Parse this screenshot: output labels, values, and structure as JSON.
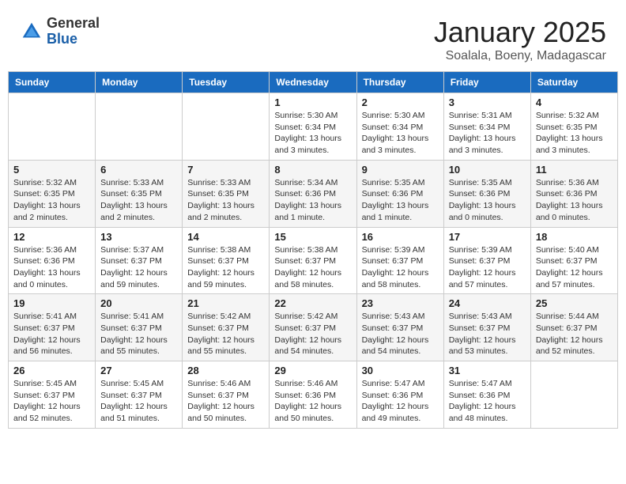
{
  "logo": {
    "general": "General",
    "blue": "Blue"
  },
  "header": {
    "month": "January 2025",
    "location": "Soalala, Boeny, Madagascar"
  },
  "weekdays": [
    "Sunday",
    "Monday",
    "Tuesday",
    "Wednesday",
    "Thursday",
    "Friday",
    "Saturday"
  ],
  "weeks": [
    [
      {
        "day": "",
        "info": ""
      },
      {
        "day": "",
        "info": ""
      },
      {
        "day": "",
        "info": ""
      },
      {
        "day": "1",
        "info": "Sunrise: 5:30 AM\nSunset: 6:34 PM\nDaylight: 13 hours\nand 3 minutes."
      },
      {
        "day": "2",
        "info": "Sunrise: 5:30 AM\nSunset: 6:34 PM\nDaylight: 13 hours\nand 3 minutes."
      },
      {
        "day": "3",
        "info": "Sunrise: 5:31 AM\nSunset: 6:34 PM\nDaylight: 13 hours\nand 3 minutes."
      },
      {
        "day": "4",
        "info": "Sunrise: 5:32 AM\nSunset: 6:35 PM\nDaylight: 13 hours\nand 3 minutes."
      }
    ],
    [
      {
        "day": "5",
        "info": "Sunrise: 5:32 AM\nSunset: 6:35 PM\nDaylight: 13 hours\nand 2 minutes."
      },
      {
        "day": "6",
        "info": "Sunrise: 5:33 AM\nSunset: 6:35 PM\nDaylight: 13 hours\nand 2 minutes."
      },
      {
        "day": "7",
        "info": "Sunrise: 5:33 AM\nSunset: 6:35 PM\nDaylight: 13 hours\nand 2 minutes."
      },
      {
        "day": "8",
        "info": "Sunrise: 5:34 AM\nSunset: 6:36 PM\nDaylight: 13 hours\nand 1 minute."
      },
      {
        "day": "9",
        "info": "Sunrise: 5:35 AM\nSunset: 6:36 PM\nDaylight: 13 hours\nand 1 minute."
      },
      {
        "day": "10",
        "info": "Sunrise: 5:35 AM\nSunset: 6:36 PM\nDaylight: 13 hours\nand 0 minutes."
      },
      {
        "day": "11",
        "info": "Sunrise: 5:36 AM\nSunset: 6:36 PM\nDaylight: 13 hours\nand 0 minutes."
      }
    ],
    [
      {
        "day": "12",
        "info": "Sunrise: 5:36 AM\nSunset: 6:36 PM\nDaylight: 13 hours\nand 0 minutes."
      },
      {
        "day": "13",
        "info": "Sunrise: 5:37 AM\nSunset: 6:37 PM\nDaylight: 12 hours\nand 59 minutes."
      },
      {
        "day": "14",
        "info": "Sunrise: 5:38 AM\nSunset: 6:37 PM\nDaylight: 12 hours\nand 59 minutes."
      },
      {
        "day": "15",
        "info": "Sunrise: 5:38 AM\nSunset: 6:37 PM\nDaylight: 12 hours\nand 58 minutes."
      },
      {
        "day": "16",
        "info": "Sunrise: 5:39 AM\nSunset: 6:37 PM\nDaylight: 12 hours\nand 58 minutes."
      },
      {
        "day": "17",
        "info": "Sunrise: 5:39 AM\nSunset: 6:37 PM\nDaylight: 12 hours\nand 57 minutes."
      },
      {
        "day": "18",
        "info": "Sunrise: 5:40 AM\nSunset: 6:37 PM\nDaylight: 12 hours\nand 57 minutes."
      }
    ],
    [
      {
        "day": "19",
        "info": "Sunrise: 5:41 AM\nSunset: 6:37 PM\nDaylight: 12 hours\nand 56 minutes."
      },
      {
        "day": "20",
        "info": "Sunrise: 5:41 AM\nSunset: 6:37 PM\nDaylight: 12 hours\nand 55 minutes."
      },
      {
        "day": "21",
        "info": "Sunrise: 5:42 AM\nSunset: 6:37 PM\nDaylight: 12 hours\nand 55 minutes."
      },
      {
        "day": "22",
        "info": "Sunrise: 5:42 AM\nSunset: 6:37 PM\nDaylight: 12 hours\nand 54 minutes."
      },
      {
        "day": "23",
        "info": "Sunrise: 5:43 AM\nSunset: 6:37 PM\nDaylight: 12 hours\nand 54 minutes."
      },
      {
        "day": "24",
        "info": "Sunrise: 5:43 AM\nSunset: 6:37 PM\nDaylight: 12 hours\nand 53 minutes."
      },
      {
        "day": "25",
        "info": "Sunrise: 5:44 AM\nSunset: 6:37 PM\nDaylight: 12 hours\nand 52 minutes."
      }
    ],
    [
      {
        "day": "26",
        "info": "Sunrise: 5:45 AM\nSunset: 6:37 PM\nDaylight: 12 hours\nand 52 minutes."
      },
      {
        "day": "27",
        "info": "Sunrise: 5:45 AM\nSunset: 6:37 PM\nDaylight: 12 hours\nand 51 minutes."
      },
      {
        "day": "28",
        "info": "Sunrise: 5:46 AM\nSunset: 6:37 PM\nDaylight: 12 hours\nand 50 minutes."
      },
      {
        "day": "29",
        "info": "Sunrise: 5:46 AM\nSunset: 6:36 PM\nDaylight: 12 hours\nand 50 minutes."
      },
      {
        "day": "30",
        "info": "Sunrise: 5:47 AM\nSunset: 6:36 PM\nDaylight: 12 hours\nand 49 minutes."
      },
      {
        "day": "31",
        "info": "Sunrise: 5:47 AM\nSunset: 6:36 PM\nDaylight: 12 hours\nand 48 minutes."
      },
      {
        "day": "",
        "info": ""
      }
    ]
  ]
}
